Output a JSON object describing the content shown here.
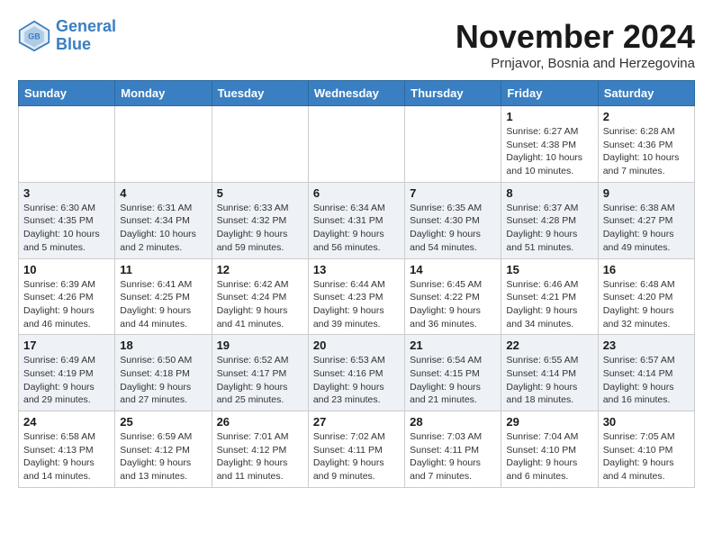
{
  "header": {
    "logo_line1": "General",
    "logo_line2": "Blue",
    "month_title": "November 2024",
    "location": "Prnjavor, Bosnia and Herzegovina"
  },
  "weekdays": [
    "Sunday",
    "Monday",
    "Tuesday",
    "Wednesday",
    "Thursday",
    "Friday",
    "Saturday"
  ],
  "weeks": [
    {
      "days": [
        {
          "num": "",
          "info": ""
        },
        {
          "num": "",
          "info": ""
        },
        {
          "num": "",
          "info": ""
        },
        {
          "num": "",
          "info": ""
        },
        {
          "num": "",
          "info": ""
        },
        {
          "num": "1",
          "info": "Sunrise: 6:27 AM\nSunset: 4:38 PM\nDaylight: 10 hours\nand 10 minutes."
        },
        {
          "num": "2",
          "info": "Sunrise: 6:28 AM\nSunset: 4:36 PM\nDaylight: 10 hours\nand 7 minutes."
        }
      ]
    },
    {
      "days": [
        {
          "num": "3",
          "info": "Sunrise: 6:30 AM\nSunset: 4:35 PM\nDaylight: 10 hours\nand 5 minutes."
        },
        {
          "num": "4",
          "info": "Sunrise: 6:31 AM\nSunset: 4:34 PM\nDaylight: 10 hours\nand 2 minutes."
        },
        {
          "num": "5",
          "info": "Sunrise: 6:33 AM\nSunset: 4:32 PM\nDaylight: 9 hours\nand 59 minutes."
        },
        {
          "num": "6",
          "info": "Sunrise: 6:34 AM\nSunset: 4:31 PM\nDaylight: 9 hours\nand 56 minutes."
        },
        {
          "num": "7",
          "info": "Sunrise: 6:35 AM\nSunset: 4:30 PM\nDaylight: 9 hours\nand 54 minutes."
        },
        {
          "num": "8",
          "info": "Sunrise: 6:37 AM\nSunset: 4:28 PM\nDaylight: 9 hours\nand 51 minutes."
        },
        {
          "num": "9",
          "info": "Sunrise: 6:38 AM\nSunset: 4:27 PM\nDaylight: 9 hours\nand 49 minutes."
        }
      ]
    },
    {
      "days": [
        {
          "num": "10",
          "info": "Sunrise: 6:39 AM\nSunset: 4:26 PM\nDaylight: 9 hours\nand 46 minutes."
        },
        {
          "num": "11",
          "info": "Sunrise: 6:41 AM\nSunset: 4:25 PM\nDaylight: 9 hours\nand 44 minutes."
        },
        {
          "num": "12",
          "info": "Sunrise: 6:42 AM\nSunset: 4:24 PM\nDaylight: 9 hours\nand 41 minutes."
        },
        {
          "num": "13",
          "info": "Sunrise: 6:44 AM\nSunset: 4:23 PM\nDaylight: 9 hours\nand 39 minutes."
        },
        {
          "num": "14",
          "info": "Sunrise: 6:45 AM\nSunset: 4:22 PM\nDaylight: 9 hours\nand 36 minutes."
        },
        {
          "num": "15",
          "info": "Sunrise: 6:46 AM\nSunset: 4:21 PM\nDaylight: 9 hours\nand 34 minutes."
        },
        {
          "num": "16",
          "info": "Sunrise: 6:48 AM\nSunset: 4:20 PM\nDaylight: 9 hours\nand 32 minutes."
        }
      ]
    },
    {
      "days": [
        {
          "num": "17",
          "info": "Sunrise: 6:49 AM\nSunset: 4:19 PM\nDaylight: 9 hours\nand 29 minutes."
        },
        {
          "num": "18",
          "info": "Sunrise: 6:50 AM\nSunset: 4:18 PM\nDaylight: 9 hours\nand 27 minutes."
        },
        {
          "num": "19",
          "info": "Sunrise: 6:52 AM\nSunset: 4:17 PM\nDaylight: 9 hours\nand 25 minutes."
        },
        {
          "num": "20",
          "info": "Sunrise: 6:53 AM\nSunset: 4:16 PM\nDaylight: 9 hours\nand 23 minutes."
        },
        {
          "num": "21",
          "info": "Sunrise: 6:54 AM\nSunset: 4:15 PM\nDaylight: 9 hours\nand 21 minutes."
        },
        {
          "num": "22",
          "info": "Sunrise: 6:55 AM\nSunset: 4:14 PM\nDaylight: 9 hours\nand 18 minutes."
        },
        {
          "num": "23",
          "info": "Sunrise: 6:57 AM\nSunset: 4:14 PM\nDaylight: 9 hours\nand 16 minutes."
        }
      ]
    },
    {
      "days": [
        {
          "num": "24",
          "info": "Sunrise: 6:58 AM\nSunset: 4:13 PM\nDaylight: 9 hours\nand 14 minutes."
        },
        {
          "num": "25",
          "info": "Sunrise: 6:59 AM\nSunset: 4:12 PM\nDaylight: 9 hours\nand 13 minutes."
        },
        {
          "num": "26",
          "info": "Sunrise: 7:01 AM\nSunset: 4:12 PM\nDaylight: 9 hours\nand 11 minutes."
        },
        {
          "num": "27",
          "info": "Sunrise: 7:02 AM\nSunset: 4:11 PM\nDaylight: 9 hours\nand 9 minutes."
        },
        {
          "num": "28",
          "info": "Sunrise: 7:03 AM\nSunset: 4:11 PM\nDaylight: 9 hours\nand 7 minutes."
        },
        {
          "num": "29",
          "info": "Sunrise: 7:04 AM\nSunset: 4:10 PM\nDaylight: 9 hours\nand 6 minutes."
        },
        {
          "num": "30",
          "info": "Sunrise: 7:05 AM\nSunset: 4:10 PM\nDaylight: 9 hours\nand 4 minutes."
        }
      ]
    }
  ]
}
